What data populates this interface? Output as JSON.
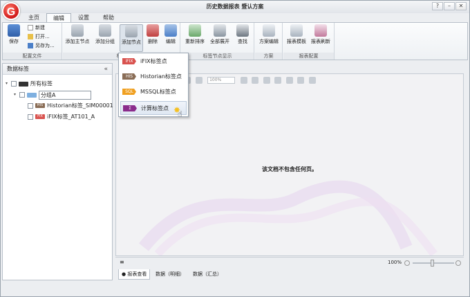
{
  "app": {
    "title": "历史数据报表 暨认方案",
    "logo_letter": "G"
  },
  "window_controls": {
    "minimize": "–",
    "maximize": "□",
    "close": "✕",
    "help": "?"
  },
  "tabs": [
    {
      "label": "主页",
      "active": false
    },
    {
      "label": "编辑",
      "active": true
    },
    {
      "label": "设置",
      "active": false
    },
    {
      "label": "帮助",
      "active": false
    }
  ],
  "ribbon": {
    "config_file": {
      "label": "配置文件",
      "save": "保存",
      "new": "新建",
      "open": "打开...",
      "save_as": "另存为..."
    },
    "tags": {
      "label": "标签",
      "add_main": "添加主节点",
      "add_group": "添加分组",
      "add_node": "添加节点",
      "delete": "删除",
      "edit": "编辑"
    },
    "tag_display": {
      "label": "标签节点显示",
      "reorder": "重新排序",
      "expand_all": "全部展开",
      "find": "查找"
    },
    "scheme": {
      "label": "方案",
      "scheme_edit": "方案编辑"
    },
    "report_config": {
      "label": "报表配置",
      "report_template": "报表模板",
      "report_refresh": "报表刷新"
    }
  },
  "dropdown_menu": [
    {
      "tag": "iFIX",
      "label": "iFIX标签点",
      "color": "#d9534f",
      "highlighted": false
    },
    {
      "tag": "HIS",
      "label": "Historian标签点",
      "color": "#8a6d56",
      "highlighted": false
    },
    {
      "tag": "SQL",
      "label": "MSSQL标签点",
      "color": "#f0a020",
      "highlighted": false
    },
    {
      "tag": "Σ",
      "label": "计算标签点",
      "color": "#8a2c8c",
      "highlighted": true
    }
  ],
  "left_panel": {
    "title": "数据标签",
    "collapse_icon": "«",
    "tree": {
      "root": {
        "label": "所有标签"
      },
      "group": {
        "label": "分组A"
      },
      "items": [
        {
          "tag": "HIS",
          "label": "Historian标签_SIM00001",
          "color": "#8a6d56"
        },
        {
          "tag": "FIX",
          "label": "iFIX标签_AT101_A",
          "color": "#d9534f"
        }
      ]
    }
  },
  "viewer": {
    "zoom_value": "100%",
    "empty_message": "该文档不包含任何页。"
  },
  "status": {
    "left_icon": "≡",
    "zoom": "100%"
  },
  "bottom_tabs": [
    {
      "label": "报表查看",
      "active": true
    },
    {
      "label": "数据（明细）",
      "active": false
    },
    {
      "label": "数据（汇总）",
      "active": false
    }
  ],
  "colors": {
    "accent": "#3a78c9",
    "purple": "#8a2c8c"
  }
}
